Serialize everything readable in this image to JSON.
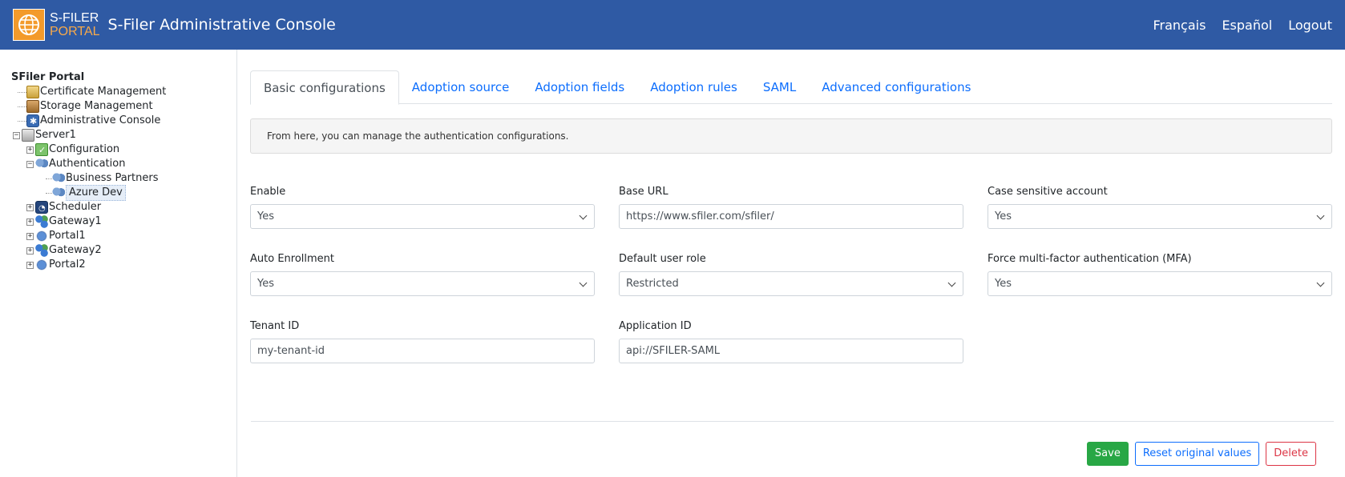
{
  "header": {
    "logo_line1": "S-FILER",
    "logo_line2": "PORTAL",
    "title": "S-Filer Administrative Console",
    "links": [
      "Français",
      "Español",
      "Logout"
    ],
    "color": "#2f5aa4"
  },
  "tree": {
    "root": "SFiler Portal",
    "items": [
      {
        "label": "Certificate Management",
        "icon": "certificate-icon"
      },
      {
        "label": "Storage Management",
        "icon": "storage-icon"
      },
      {
        "label": "Administrative Console",
        "icon": "admin-console-icon"
      },
      {
        "label": "Server1",
        "icon": "server-icon"
      },
      {
        "label": "Configuration",
        "icon": "configuration-icon"
      },
      {
        "label": "Authentication",
        "icon": "users-icon"
      },
      {
        "label": "Business Partners",
        "icon": "users-icon"
      },
      {
        "label": "Azure Dev",
        "icon": "users-icon"
      },
      {
        "label": "Scheduler",
        "icon": "scheduler-icon"
      },
      {
        "label": "Gateway1",
        "icon": "gateway-icon"
      },
      {
        "label": "Portal1",
        "icon": "portal-icon"
      },
      {
        "label": "Gateway2",
        "icon": "gateway-icon"
      },
      {
        "label": "Portal2",
        "icon": "portal-icon"
      }
    ]
  },
  "tabs": [
    "Basic configurations",
    "Adoption source",
    "Adoption fields",
    "Adoption rules",
    "SAML",
    "Advanced configurations"
  ],
  "info": "From here, you can manage the authentication configurations.",
  "form": {
    "enable": {
      "label": "Enable",
      "value": "Yes"
    },
    "base_url": {
      "label": "Base URL",
      "value": "https://www.sfiler.com/sfiler/"
    },
    "case_sensitive": {
      "label": "Case sensitive account",
      "value": "Yes"
    },
    "auto_enrollment": {
      "label": "Auto Enrollment",
      "value": "Yes"
    },
    "default_role": {
      "label": "Default user role",
      "value": "Restricted"
    },
    "force_mfa": {
      "label": "Force multi-factor authentication (MFA)",
      "value": "Yes"
    },
    "tenant_id": {
      "label": "Tenant ID",
      "value": "my-tenant-id"
    },
    "application_id": {
      "label": "Application ID",
      "value": "api://SFILER-SAML"
    }
  },
  "actions": {
    "save": "Save",
    "reset": "Reset original values",
    "delete": "Delete"
  }
}
